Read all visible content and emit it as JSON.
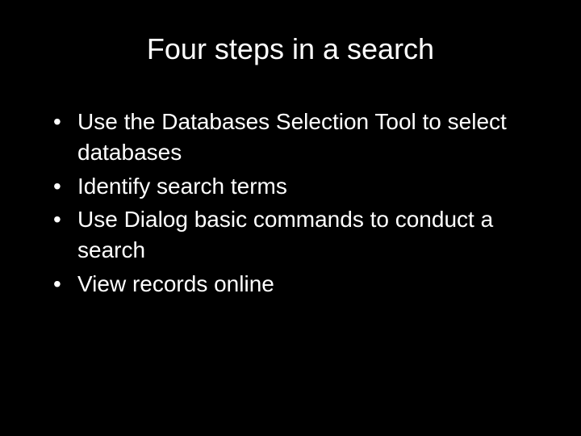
{
  "slide": {
    "title": "Four steps in a search",
    "bullets": [
      "Use the Databases Selection Tool to select databases",
      "Identify search terms",
      "Use Dialog basic commands to conduct a search",
      "View records online"
    ]
  }
}
